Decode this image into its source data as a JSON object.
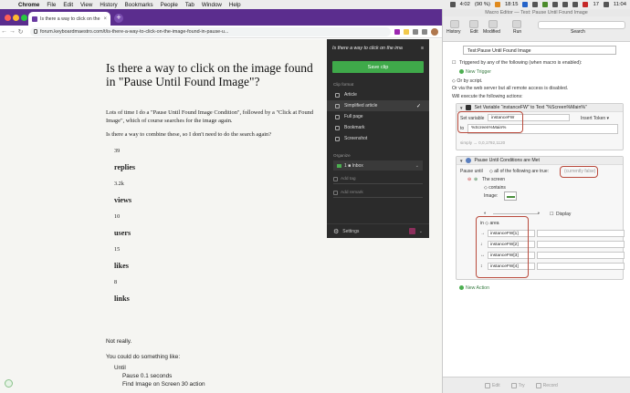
{
  "menubar": {
    "app": "Chrome",
    "items": [
      "File",
      "Edit",
      "View",
      "History",
      "Bookmarks",
      "People",
      "Tab",
      "Window",
      "Help"
    ],
    "clock_left": "4:02",
    "battery": "(90 %)",
    "clock_mid": "18:15",
    "day": "17",
    "time": "11:04"
  },
  "browser": {
    "tab_title": "Is there a way to click on the ima",
    "url": "forum.keyboardmaestro.com/t/is-there-a-way-to-click-on-the-image-found-in-pause-u..."
  },
  "article": {
    "title": "Is there a way to click on the image found in \"Pause Until Found Image\"?",
    "p1": "Lots of time I do a \"Pause Until Found Image Condition\", followed by a \"Click at Found Image\", which of course searches for the image again.",
    "p2": "Is there a way to combine these, so I don't need to do the search again?",
    "stats": [
      {
        "num": "39",
        "label": "replies"
      },
      {
        "num": "3.2k",
        "label": "views"
      },
      {
        "num": "10",
        "label": "users"
      },
      {
        "num": "15",
        "label": "likes"
      },
      {
        "num": "8",
        "label": "links"
      }
    ],
    "not_really": "Not really.",
    "could_do": "You could do something like:",
    "until": "Until",
    "pause": "Pause 0.1 seconds",
    "find": "Find Image on Screen 30 action"
  },
  "clipper": {
    "title": "Is there a way to click on the ima",
    "save": "Save clip",
    "format_heading": "Clip format",
    "formats": [
      {
        "label": "Article",
        "selected": false
      },
      {
        "label": "Simplified article",
        "selected": true
      },
      {
        "label": "Full page",
        "selected": false
      },
      {
        "label": "Bookmark",
        "selected": false
      },
      {
        "label": "Screenshot",
        "selected": false
      }
    ],
    "check": "✓",
    "org_heading": "Organize",
    "notebook": "1 ■ Inbox",
    "add_tag": "Add tag",
    "add_remark": "Add remark",
    "settings": "Settings"
  },
  "km": {
    "window_title": "Macro Editor — Test: Pause Until Found Image",
    "toolbar": {
      "history": "History",
      "edit": "Edit",
      "modified": "Modified",
      "run": "Run",
      "search": "Search"
    },
    "macro_name": "Test:Pause Until Found Image",
    "triggered": "Triggered by any of the following (when macro is enabled):",
    "new_trigger": "New Trigger",
    "or_script": "◇ Or by script.",
    "or_web": "Or via the web server but all remote access is disabled.",
    "will_execute": "Will execute the following actions:",
    "set_var": {
      "header": "Set Variable “instanceFW” to Text “%Screen%Main%”",
      "label_var": "Set variable",
      "var_name": "instanceFW",
      "insert_token": "Insert Token ▾",
      "to": "to",
      "value": "%Screen%Main%",
      "hint": "simply → 0,0,1792,1120"
    },
    "pause": {
      "header": "Pause Until Conditions are Met",
      "pause_until": "Pause until",
      "all_of": "◇ all of the following are true:",
      "currently": "(currently false)",
      "the_screen": "The screen",
      "contains": "◇ contains",
      "image": "Image:",
      "display": "Display",
      "in_area": "in ◇ area",
      "rows": [
        {
          "arrow": "→",
          "value": "instanceFW[1]"
        },
        {
          "arrow": "↓",
          "value": "instanceFW[2]"
        },
        {
          "arrow": "↔",
          "value": "instanceFW[3]"
        },
        {
          "arrow": "↕",
          "value": "instanceFW[4]"
        }
      ]
    },
    "new_action": "New Action",
    "bottom": {
      "edit": "Edit",
      "try": "Try",
      "record": "Record"
    }
  }
}
